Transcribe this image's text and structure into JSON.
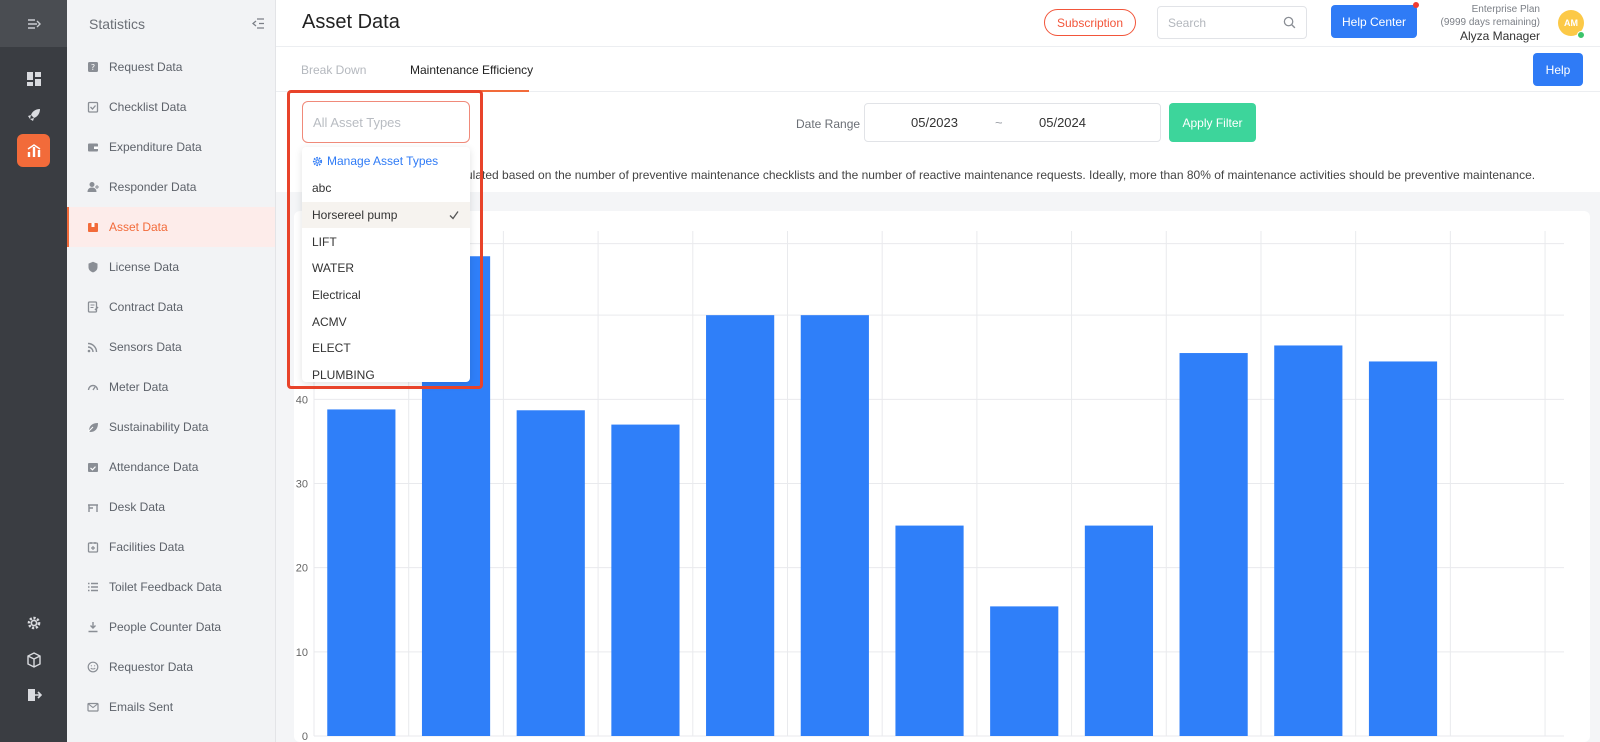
{
  "sidebar": {
    "title": "Statistics",
    "items": [
      {
        "label": "Request Data",
        "icon": "question-icon"
      },
      {
        "label": "Checklist Data",
        "icon": "checklist-icon"
      },
      {
        "label": "Expenditure Data",
        "icon": "wallet-icon"
      },
      {
        "label": "Responder Data",
        "icon": "user-icon"
      },
      {
        "label": "Asset Data",
        "icon": "box-icon",
        "active": true
      },
      {
        "label": "License Data",
        "icon": "shield-icon"
      },
      {
        "label": "Contract Data",
        "icon": "contract-icon"
      },
      {
        "label": "Sensors Data",
        "icon": "signal-icon"
      },
      {
        "label": "Meter Data",
        "icon": "gauge-icon"
      },
      {
        "label": "Sustainability Data",
        "icon": "leaf-icon"
      },
      {
        "label": "Attendance Data",
        "icon": "calendar-check-icon"
      },
      {
        "label": "Desk Data",
        "icon": "desk-icon"
      },
      {
        "label": "Facilities Data",
        "icon": "calendar-plus-icon"
      },
      {
        "label": "Toilet Feedback Data",
        "icon": "list-icon"
      },
      {
        "label": "People Counter Data",
        "icon": "download-icon"
      },
      {
        "label": "Requestor Data",
        "icon": "smile-icon"
      },
      {
        "label": "Emails Sent",
        "icon": "mail-icon"
      }
    ]
  },
  "header": {
    "title": "Asset Data",
    "subscription_label": "Subscription",
    "search_placeholder": "Search",
    "help_center_label": "Help Center",
    "plan_name": "Enterprise Plan",
    "plan_days": "(9999 days remaining)",
    "user_name": "Alyza Manager",
    "avatar_initials": "AM"
  },
  "tabs": {
    "items": [
      "Break Down",
      "Maintenance Efficiency"
    ],
    "active": 1,
    "help_label": "Help"
  },
  "filter": {
    "asset_placeholder": "All Asset Types",
    "date_range_label": "Date Range",
    "date_from": "05/2023",
    "date_sep": "~",
    "date_to": "05/2024",
    "apply_label": "Apply Filter"
  },
  "description": "culated based on the number of preventive maintenance checklists and the number of reactive maintenance requests. Ideally, more than 80% of maintenance activities should be preventive maintenance.",
  "dropdown": {
    "manage_label": "Manage Asset Types",
    "options": [
      "abc",
      "Horsereel pump",
      "LIFT",
      "WATER",
      "Electrical",
      "ACMV",
      "ELECT",
      "PLUMBING"
    ],
    "selected": "Horsereel pump"
  },
  "colors": {
    "accent": "#f26b3a",
    "primary": "#2f7bf6",
    "success": "#3dd59b",
    "bar": "#2f7ff9"
  },
  "chart_data": {
    "type": "bar",
    "values": [
      38.8,
      57,
      38.7,
      37,
      50,
      50,
      25,
      15.4,
      25,
      45.5,
      46.4,
      44.5
    ],
    "yticks": [
      0,
      10,
      20,
      30,
      40
    ],
    "ylim": [
      0,
      60
    ],
    "grid": true
  }
}
